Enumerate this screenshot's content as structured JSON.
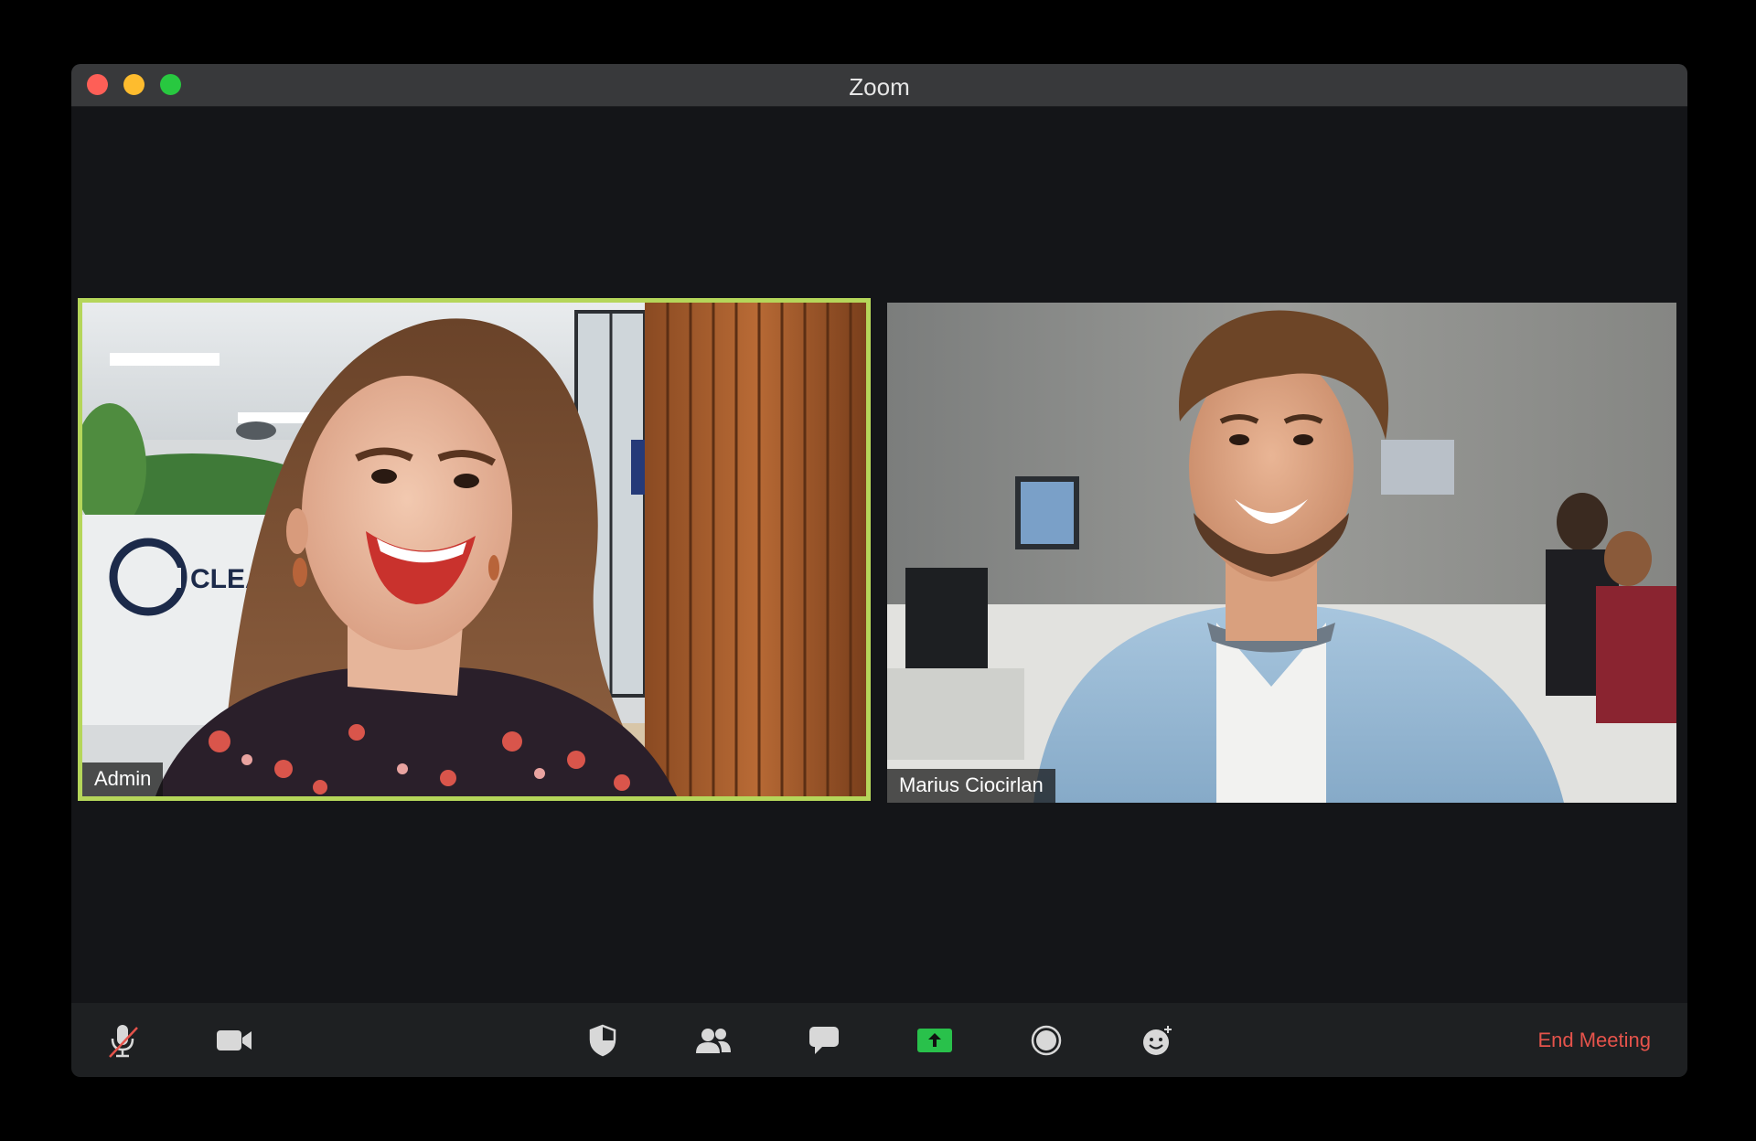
{
  "window": {
    "title": "Zoom"
  },
  "participants": [
    {
      "name": "Admin",
      "active_speaker": true,
      "background_logo_text": "CLEA"
    },
    {
      "name": "Marius Ciocirlan",
      "active_speaker": false
    }
  ],
  "toolbar": {
    "items": [
      {
        "icon": "microphone-muted-icon",
        "state": "muted"
      },
      {
        "icon": "video-camera-icon"
      },
      {
        "icon": "security-shield-icon"
      },
      {
        "icon": "participants-icon"
      },
      {
        "icon": "chat-icon"
      },
      {
        "icon": "share-screen-icon",
        "accent": "#29c14b"
      },
      {
        "icon": "record-icon"
      },
      {
        "icon": "reactions-icon"
      }
    ],
    "end_meeting_label": "End Meeting",
    "end_meeting_color": "#e5534b"
  },
  "colors": {
    "active_speaker_border": "#b5d65a",
    "window_bg": "#141518",
    "titlebar_bg": "#38393b"
  }
}
